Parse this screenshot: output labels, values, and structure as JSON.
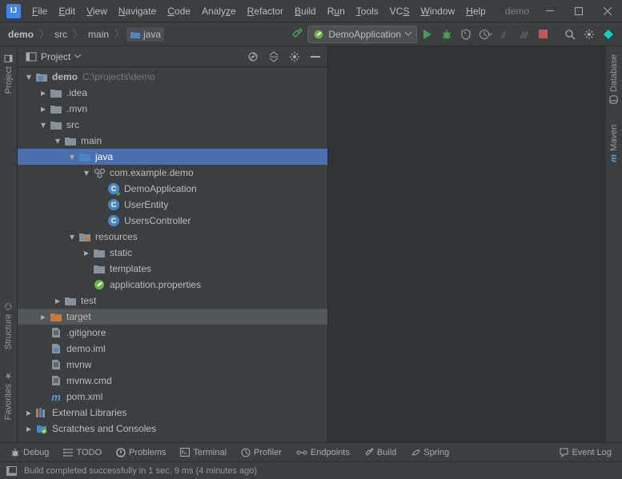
{
  "app": {
    "project_label": "demo"
  },
  "menu": {
    "file": "File",
    "edit": "Edit",
    "view": "View",
    "navigate": "Navigate",
    "code": "Code",
    "analyze": "Analyze",
    "refactor": "Refactor",
    "build": "Build",
    "run": "Run",
    "tools": "Tools",
    "vcs": "VCS",
    "window": "Window",
    "help": "Help"
  },
  "breadcrumbs": {
    "c0": "demo",
    "c1": "src",
    "c2": "main",
    "c3": "java"
  },
  "run_config": {
    "label": "DemoApplication"
  },
  "panel": {
    "title": "Project"
  },
  "tree": {
    "root": {
      "label": "demo",
      "path": "C:\\projects\\demo"
    },
    "idea": ".idea",
    "mvn": ".mvn",
    "src": "src",
    "main": "main",
    "java": "java",
    "pkg": "com.example.demo",
    "cls1": "DemoApplication",
    "cls2": "UserEntity",
    "cls3": "UsersController",
    "resources": "resources",
    "static": "static",
    "templates": "templates",
    "appprops": "application.properties",
    "test": "test",
    "target": "target",
    "gitignore": ".gitignore",
    "iml": "demo.iml",
    "mvnw": "mvnw",
    "mvnwcmd": "mvnw.cmd",
    "pom": "pom.xml",
    "extlib": "External Libraries",
    "scratch": "Scratches and Consoles"
  },
  "left_tabs": {
    "project": "Project",
    "structure": "Structure",
    "favorites": "Favorites"
  },
  "right_tabs": {
    "database": "Database",
    "maven": "Maven"
  },
  "bottom": {
    "debug": "Debug",
    "todo": "TODO",
    "problems": "Problems",
    "terminal": "Terminal",
    "profiler": "Profiler",
    "endpoints": "Endpoints",
    "build": "Build",
    "spring": "Spring",
    "eventlog": "Event Log"
  },
  "status": {
    "message": "Build completed successfully in 1 sec, 9 ms (4 minutes ago)"
  }
}
